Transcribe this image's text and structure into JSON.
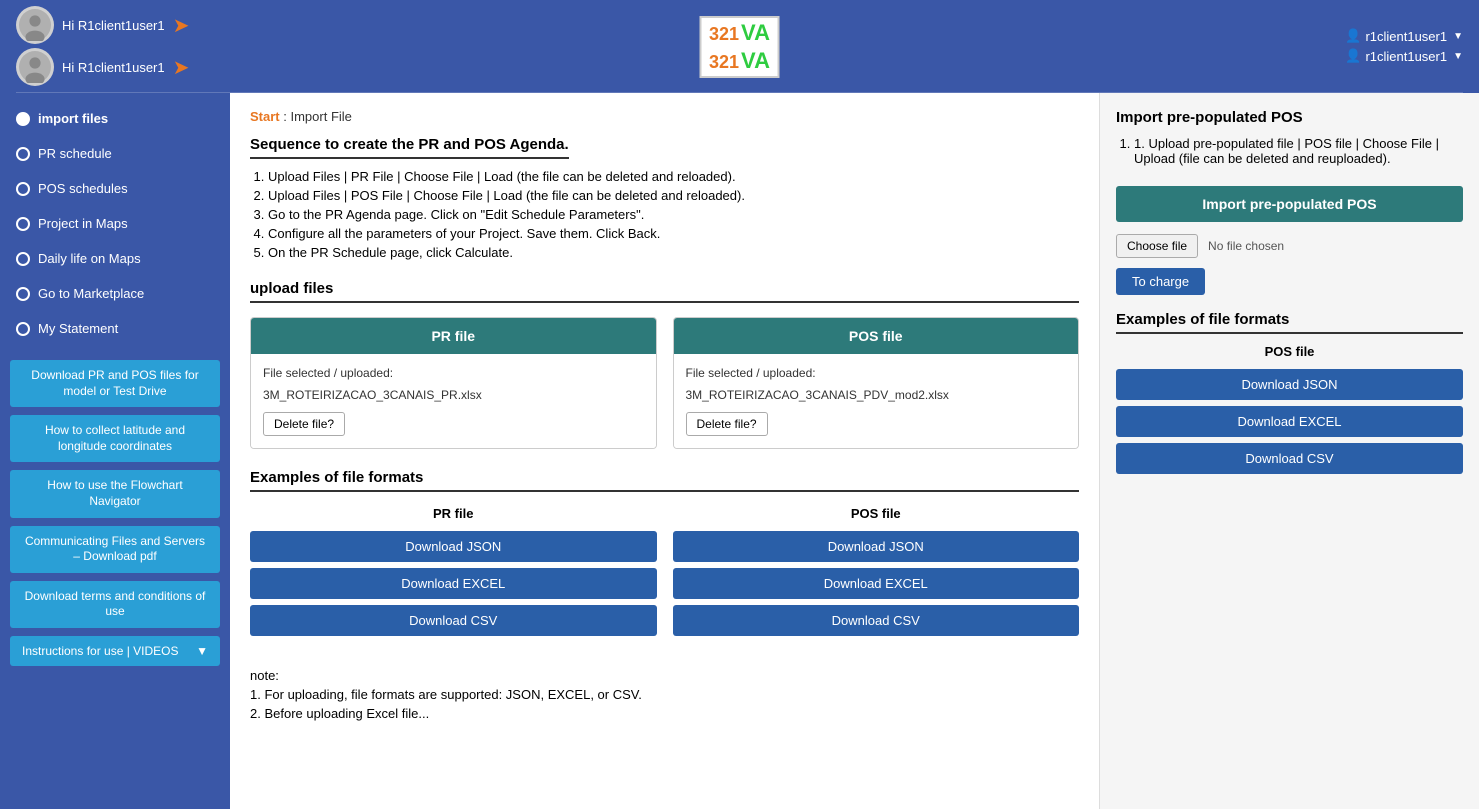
{
  "header": {
    "rows": [
      {
        "greeting": "Hi R1client1user1",
        "username": "r1client1user1"
      },
      {
        "greeting": "Hi R1client1user1",
        "username": "r1client1user1"
      }
    ],
    "logo_top": "321",
    "logo_bottom": "VA"
  },
  "sidebar": {
    "nav_items": [
      {
        "label": "import files",
        "active": true
      },
      {
        "label": "PR schedule",
        "active": false
      },
      {
        "label": "POS schedules",
        "active": false
      },
      {
        "label": "Project in Maps",
        "active": false
      },
      {
        "label": "Daily life on Maps",
        "active": false
      },
      {
        "label": "Go to Marketplace",
        "active": false
      },
      {
        "label": "My Statement",
        "active": false
      }
    ],
    "buttons": [
      {
        "label": "Download PR and POS files for model or Test Drive",
        "dropdown": false
      },
      {
        "label": "How to collect latitude and longitude coordinates",
        "dropdown": false
      },
      {
        "label": "How to use the Flowchart Navigator",
        "dropdown": false
      },
      {
        "label": "Communicating Files and Servers – Download pdf",
        "dropdown": false
      },
      {
        "label": "Download terms and conditions of use",
        "dropdown": false
      }
    ],
    "videos_btn": "Instructions for use | VIDEOS"
  },
  "breadcrumb": {
    "start_label": "Start",
    "separator": " : ",
    "current": "Import File"
  },
  "main": {
    "sequence_title": "Sequence to create the PR and POS Agenda.",
    "sequence_steps": [
      "Upload Files | PR File | Choose File | Load (the file can be deleted and reloaded).",
      "Upload Files | POS File | Choose File | Load (the file can be deleted and reloaded).",
      "Go to the PR Agenda page. Click on \"Edit Schedule Parameters\".",
      "Configure all the parameters of your Project. Save them. Click Back.",
      "On the PR Schedule page, click Calculate."
    ],
    "upload_title": "upload files",
    "pr_card": {
      "header": "PR file",
      "file_label": "File selected / uploaded:",
      "file_name": "3M_ROTEIRIZACAO_3CANAIS_PR.xlsx",
      "delete_btn": "Delete file?"
    },
    "pos_card": {
      "header": "POS file",
      "file_label": "File selected / uploaded:",
      "file_name": "3M_ROTEIRIZACAO_3CANAIS_PDV_mod2.xlsx",
      "delete_btn": "Delete file?"
    },
    "examples_title": "Examples of file formats",
    "pr_examples": {
      "subtitle": "PR file",
      "btn_json": "Download JSON",
      "btn_excel": "Download EXCEL",
      "btn_csv": "Download CSV"
    },
    "pos_examples": {
      "subtitle": "POS file",
      "btn_json": "Download JSON",
      "btn_excel": "Download EXCEL",
      "btn_csv": "Download CSV"
    },
    "notes_title": "note:",
    "notes": [
      "1. For uploading, file formats are supported: JSON, EXCEL, or CSV.",
      "2. Before uploading Excel file..."
    ]
  },
  "right_panel": {
    "title": "Import pre-populated POS",
    "instructions": [
      "1. Upload pre-populated file | POS file | Choose File | Upload (file can be deleted and reuploaded)."
    ],
    "import_btn": "Import pre-populated POS",
    "choose_file_btn": "Choose file",
    "no_file_text": "No file chosen",
    "to_charge_btn": "To charge",
    "examples_title": "Examples of file formats",
    "pos_examples": {
      "subtitle": "POS file",
      "btn_json": "Download JSON",
      "btn_excel": "Download EXCEL",
      "btn_csv": "Download CSV"
    }
  }
}
